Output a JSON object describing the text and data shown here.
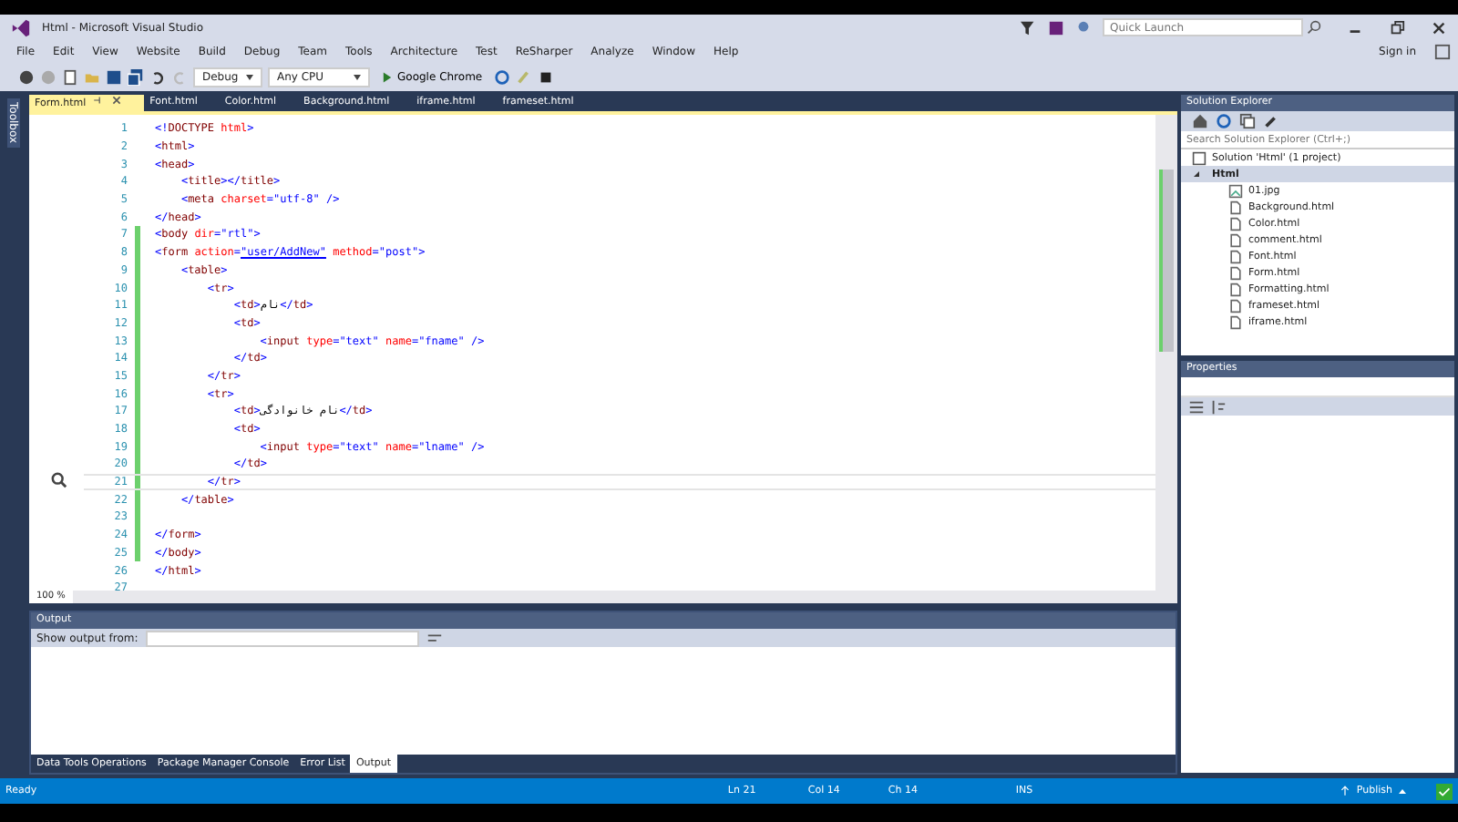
{
  "window": {
    "title": "Html - Microsoft Visual Studio",
    "quick_launch": {
      "placeholder": "Quick Launch"
    },
    "sign_in": "Sign in"
  },
  "menu": [
    "File",
    "Edit",
    "View",
    "Website",
    "Build",
    "Debug",
    "Team",
    "Tools",
    "Architecture",
    "Test",
    "ReSharper",
    "Analyze",
    "Window",
    "Help"
  ],
  "toolbar": {
    "configuration": "Debug",
    "platform": "Any CPU",
    "browser": "Google Chrome"
  },
  "toolbox_label": "Toolbox",
  "tabs": [
    {
      "label": "Form.html",
      "selected": true
    },
    {
      "label": "Font.html",
      "selected": false
    },
    {
      "label": "Color.html",
      "selected": false
    },
    {
      "label": "Background.html",
      "selected": false
    },
    {
      "label": "iframe.html",
      "selected": false
    },
    {
      "label": "frameset.html",
      "selected": false
    }
  ],
  "code_lines": [
    {
      "num": "1",
      "segments": [
        {
          "kind": "punct",
          "text": "<!"
        },
        {
          "kind": "tag",
          "text": "DOCTYPE "
        },
        {
          "kind": "attr",
          "text": "html"
        },
        {
          "kind": "punct",
          "text": ">"
        }
      ]
    },
    {
      "num": "2",
      "segments": [
        {
          "kind": "punct",
          "text": "<"
        },
        {
          "kind": "tag",
          "text": "html"
        },
        {
          "kind": "punct",
          "text": ">"
        }
      ]
    },
    {
      "num": "3",
      "segments": [
        {
          "kind": "punct",
          "text": "<"
        },
        {
          "kind": "tag",
          "text": "head"
        },
        {
          "kind": "punct",
          "text": ">"
        }
      ]
    },
    {
      "num": "4",
      "segments": [
        {
          "kind": "punct",
          "text": "    <"
        },
        {
          "kind": "tag",
          "text": "title"
        },
        {
          "kind": "punct",
          "text": "></"
        },
        {
          "kind": "tag",
          "text": "title"
        },
        {
          "kind": "punct",
          "text": ">"
        }
      ]
    },
    {
      "num": "5",
      "segments": [
        {
          "kind": "punct",
          "text": "    <"
        },
        {
          "kind": "tag",
          "text": "meta "
        },
        {
          "kind": "attr",
          "text": "charset"
        },
        {
          "kind": "punct",
          "text": "="
        },
        {
          "kind": "value",
          "text": "\"utf-8\""
        },
        {
          "kind": "punct",
          "text": " />"
        }
      ]
    },
    {
      "num": "6",
      "segments": [
        {
          "kind": "punct",
          "text": "</"
        },
        {
          "kind": "tag",
          "text": "head"
        },
        {
          "kind": "punct",
          "text": ">"
        }
      ]
    },
    {
      "num": "7",
      "segments": [
        {
          "kind": "punct",
          "text": "<"
        },
        {
          "kind": "tag",
          "text": "body "
        },
        {
          "kind": "attr",
          "text": "dir"
        },
        {
          "kind": "punct",
          "text": "="
        },
        {
          "kind": "value",
          "text": "\"rtl\""
        },
        {
          "kind": "punct",
          "text": ">"
        }
      ]
    },
    {
      "num": "8",
      "segments": [
        {
          "kind": "punct",
          "text": "<"
        },
        {
          "kind": "tag",
          "text": "form "
        },
        {
          "kind": "attr",
          "text": "action"
        },
        {
          "kind": "punct",
          "text": "="
        },
        {
          "kind": "link",
          "text": "\"user/AddNew\""
        },
        {
          "kind": "attr",
          "text": " method"
        },
        {
          "kind": "punct",
          "text": "="
        },
        {
          "kind": "value",
          "text": "\"post\""
        },
        {
          "kind": "punct",
          "text": ">"
        }
      ]
    },
    {
      "num": "9",
      "segments": [
        {
          "kind": "punct",
          "text": "    <"
        },
        {
          "kind": "tag",
          "text": "table"
        },
        {
          "kind": "punct",
          "text": ">"
        }
      ]
    },
    {
      "num": "10",
      "segments": [
        {
          "kind": "punct",
          "text": "        <"
        },
        {
          "kind": "tag",
          "text": "tr"
        },
        {
          "kind": "punct",
          "text": ">"
        }
      ]
    },
    {
      "num": "11",
      "segments": [
        {
          "kind": "punct",
          "text": "            <"
        },
        {
          "kind": "tag",
          "text": "td"
        },
        {
          "kind": "punct",
          "text": ">"
        },
        {
          "kind": "plain",
          "text": "نام"
        },
        {
          "kind": "punct",
          "text": "</"
        },
        {
          "kind": "tag",
          "text": "td"
        },
        {
          "kind": "punct",
          "text": ">"
        }
      ]
    },
    {
      "num": "12",
      "segments": [
        {
          "kind": "punct",
          "text": "            <"
        },
        {
          "kind": "tag",
          "text": "td"
        },
        {
          "kind": "punct",
          "text": ">"
        }
      ]
    },
    {
      "num": "13",
      "segments": [
        {
          "kind": "punct",
          "text": "                <"
        },
        {
          "kind": "tag",
          "text": "input "
        },
        {
          "kind": "attr",
          "text": "type"
        },
        {
          "kind": "punct",
          "text": "="
        },
        {
          "kind": "value",
          "text": "\"text\""
        },
        {
          "kind": "attr",
          "text": " name"
        },
        {
          "kind": "punct",
          "text": "="
        },
        {
          "kind": "value",
          "text": "\"fname\""
        },
        {
          "kind": "punct",
          "text": " />"
        }
      ]
    },
    {
      "num": "14",
      "segments": [
        {
          "kind": "punct",
          "text": "            </"
        },
        {
          "kind": "tag",
          "text": "td"
        },
        {
          "kind": "punct",
          "text": ">"
        }
      ]
    },
    {
      "num": "15",
      "segments": [
        {
          "kind": "punct",
          "text": "        </"
        },
        {
          "kind": "tag",
          "text": "tr"
        },
        {
          "kind": "punct",
          "text": ">"
        }
      ]
    },
    {
      "num": "16",
      "segments": [
        {
          "kind": "punct",
          "text": "        <"
        },
        {
          "kind": "tag",
          "text": "tr"
        },
        {
          "kind": "punct",
          "text": ">"
        }
      ]
    },
    {
      "num": "17",
      "segments": [
        {
          "kind": "punct",
          "text": "            <"
        },
        {
          "kind": "tag",
          "text": "td"
        },
        {
          "kind": "punct",
          "text": ">"
        },
        {
          "kind": "plain",
          "text": "نام خانوادگی"
        },
        {
          "kind": "punct",
          "text": "</"
        },
        {
          "kind": "tag",
          "text": "td"
        },
        {
          "kind": "punct",
          "text": ">"
        }
      ]
    },
    {
      "num": "18",
      "segments": [
        {
          "kind": "punct",
          "text": "            <"
        },
        {
          "kind": "tag",
          "text": "td"
        },
        {
          "kind": "punct",
          "text": ">"
        }
      ]
    },
    {
      "num": "19",
      "segments": [
        {
          "kind": "punct",
          "text": "                <"
        },
        {
          "kind": "tag",
          "text": "input "
        },
        {
          "kind": "attr",
          "text": "type"
        },
        {
          "kind": "punct",
          "text": "="
        },
        {
          "kind": "value",
          "text": "\"text\""
        },
        {
          "kind": "attr",
          "text": " name"
        },
        {
          "kind": "punct",
          "text": "="
        },
        {
          "kind": "value",
          "text": "\"lname\""
        },
        {
          "kind": "punct",
          "text": " />"
        }
      ]
    },
    {
      "num": "20",
      "segments": [
        {
          "kind": "punct",
          "text": "            </"
        },
        {
          "kind": "tag",
          "text": "td"
        },
        {
          "kind": "punct",
          "text": ">"
        }
      ]
    },
    {
      "num": "21",
      "current": true,
      "segments": [
        {
          "kind": "punct",
          "text": "        </"
        },
        {
          "kind": "tag",
          "text": "tr"
        },
        {
          "kind": "punct",
          "text": ">"
        }
      ]
    },
    {
      "num": "22",
      "segments": [
        {
          "kind": "punct",
          "text": "    </"
        },
        {
          "kind": "tag",
          "text": "table"
        },
        {
          "kind": "punct",
          "text": ">"
        }
      ]
    },
    {
      "num": "23"
    },
    {
      "num": "24",
      "segments": [
        {
          "kind": "punct",
          "text": "</"
        },
        {
          "kind": "tag",
          "text": "form"
        },
        {
          "kind": "punct",
          "text": ">"
        }
      ]
    },
    {
      "num": "25",
      "segments": [
        {
          "kind": "punct",
          "text": "</"
        },
        {
          "kind": "tag",
          "text": "body"
        },
        {
          "kind": "punct",
          "text": ">"
        }
      ]
    },
    {
      "num": "26",
      "segments": [
        {
          "kind": "punct",
          "text": "</"
        },
        {
          "kind": "tag",
          "text": "html"
        },
        {
          "kind": "punct",
          "text": ">"
        }
      ]
    },
    {
      "num": "27"
    }
  ],
  "zoom": "100 %",
  "solution_explorer": {
    "title": "Solution Explorer",
    "search": {
      "placeholder": "Search Solution Explorer (Ctrl+;)"
    },
    "solution": "Solution 'Html' (1 project)",
    "project": {
      "label": "Html",
      "expanded": true,
      "selected": true,
      "children": [
        {
          "label": "01.jpg",
          "kind": "image"
        },
        {
          "label": "Background.html",
          "kind": "file"
        },
        {
          "label": "Color.html",
          "kind": "file"
        },
        {
          "label": "comment.html",
          "kind": "file"
        },
        {
          "label": "Font.html",
          "kind": "file"
        },
        {
          "label": "Form.html",
          "kind": "file"
        },
        {
          "label": "Formatting.html",
          "kind": "file"
        },
        {
          "label": "frameset.html",
          "kind": "file"
        },
        {
          "label": "iframe.html",
          "kind": "file"
        }
      ]
    }
  },
  "properties": {
    "title": "Properties"
  },
  "output": {
    "title": "Output",
    "show_from_label": "Show output from:"
  },
  "bottom_tabs": [
    {
      "label": "Data Tools Operations",
      "selected": false
    },
    {
      "label": "Package Manager Console",
      "selected": false
    },
    {
      "label": "Error List",
      "selected": false
    },
    {
      "label": "Output",
      "selected": true
    }
  ],
  "status_bar": {
    "state": "Ready",
    "line": "Ln 21",
    "column": "Col 14",
    "char": "Ch 14",
    "mode": "INS",
    "publish": "Publish"
  }
}
